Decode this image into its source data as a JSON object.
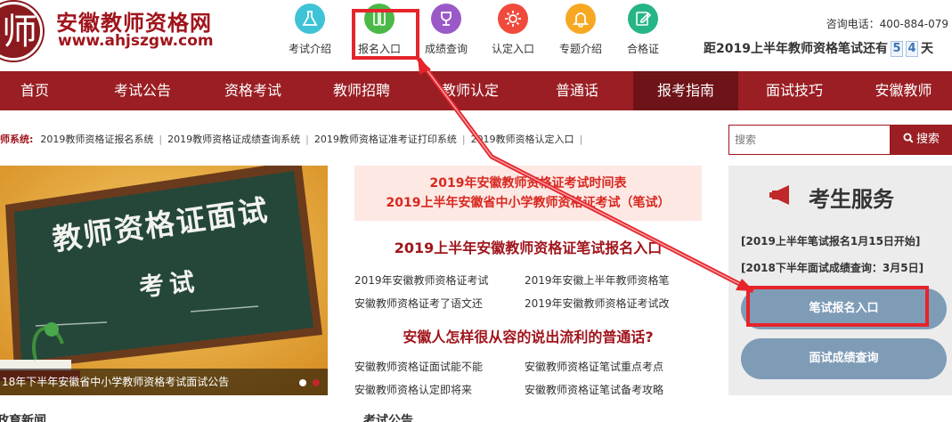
{
  "site": {
    "logo_char": "师",
    "title": "安徽教师资格网",
    "url": "www.ahjszgw.com",
    "phone": "咨询电话：400-884-079",
    "countdown_text": "距2019上半年教师资格笔试还有",
    "countdown_digits": [
      "5",
      "4"
    ],
    "countdown_tail": "天"
  },
  "topnav": [
    {
      "label": "考试介绍",
      "icon": "flask-icon",
      "color": "#3fc3d6"
    },
    {
      "label": "报名入口",
      "icon": "phone-icon",
      "color": "#4cb848"
    },
    {
      "label": "成绩查询",
      "icon": "trophy-icon",
      "color": "#9b59c8"
    },
    {
      "label": "认定入口",
      "icon": "gear-icon",
      "color": "#f04a3c"
    },
    {
      "label": "专题介绍",
      "icon": "bell-icon",
      "color": "#f7a823"
    },
    {
      "label": "合格证",
      "icon": "pencil-icon",
      "color": "#26b587"
    }
  ],
  "mainnav": [
    "首页",
    "考试公告",
    "资格考试",
    "教师招聘",
    "教师认定",
    "普通话",
    "报考指南",
    "面试技巧",
    "安徽教师"
  ],
  "mainnav_active": "报考指南",
  "ticker": {
    "label": "师系统:",
    "items": [
      "2019教师资格证报名系统",
      "2019教师资格证成绩查询系统",
      "2019教师资格证准考证打印系统",
      "2019教师资格认定入口"
    ]
  },
  "search": {
    "placeholder": "搜索",
    "button": "搜索"
  },
  "banner": {
    "chalk_title": "教师资格证面试",
    "chalk_sub": "考试",
    "caption": "18年下半年安徽省中小学教师资格考试面试公告"
  },
  "middle": {
    "head_line1": "2019年安徽教师资格证考试时间表",
    "head_line2": "2019上半年安徽省中小学教师资格证考试（笔试）",
    "title1": "2019上半年安徽教师资格证笔试报名入口",
    "links1": [
      "2019年安徽教师资格证考试",
      "2019年安徽上半年教师资格笔",
      "安徽教师资格证考了语文还",
      "2019年安徽教师资格证考试改"
    ],
    "title2": "安徽人怎样很从容的说出流利的普通话?",
    "links2": [
      "安徽教师资格证面试能不能",
      "安徽教师资格证笔试重点考点",
      "安徽教师资格认定即将来",
      "安徽教师资格证笔试备考攻略"
    ],
    "tail_left": "政育新闻",
    "tail_right": "考试公告"
  },
  "service": {
    "title": "考生服务",
    "info1": "[2019上半年笔试报名1月15日开始]",
    "info2": "[2018下半年面试成绩查询：3月5日]",
    "btn1": "笔试报名入口",
    "btn2": "面试成绩查询"
  },
  "colors": {
    "brand": "#9a1e23",
    "highlight": "#e5242b",
    "service_button": "#7f9cb7"
  }
}
